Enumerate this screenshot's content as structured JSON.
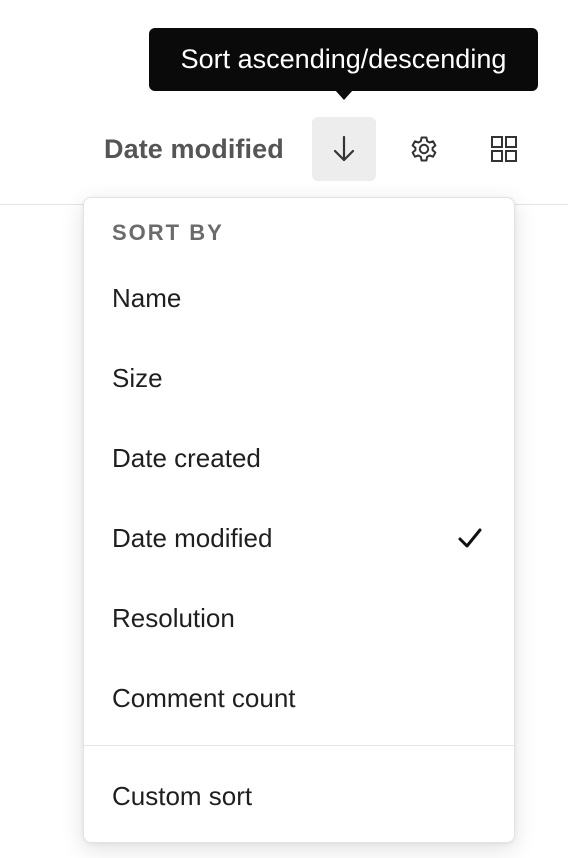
{
  "tooltip": {
    "text": "Sort ascending/descending"
  },
  "toolbar": {
    "sort_label": "Date modified",
    "sort_direction_icon": "arrow-down-icon",
    "settings_icon": "gear-icon",
    "view_icon": "grid-icon"
  },
  "menu": {
    "heading": "SORT BY",
    "items": [
      {
        "label": "Name",
        "selected": false
      },
      {
        "label": "Size",
        "selected": false
      },
      {
        "label": "Date created",
        "selected": false
      },
      {
        "label": "Date modified",
        "selected": true
      },
      {
        "label": "Resolution",
        "selected": false
      },
      {
        "label": "Comment count",
        "selected": false
      }
    ],
    "custom_label": "Custom sort",
    "check_icon": "checkmark-icon"
  },
  "colors": {
    "tooltip_bg": "#0a0a0a",
    "active_button_bg": "#ededed",
    "toolbar_label": "#555555",
    "menu_heading": "#6b6b6b"
  }
}
